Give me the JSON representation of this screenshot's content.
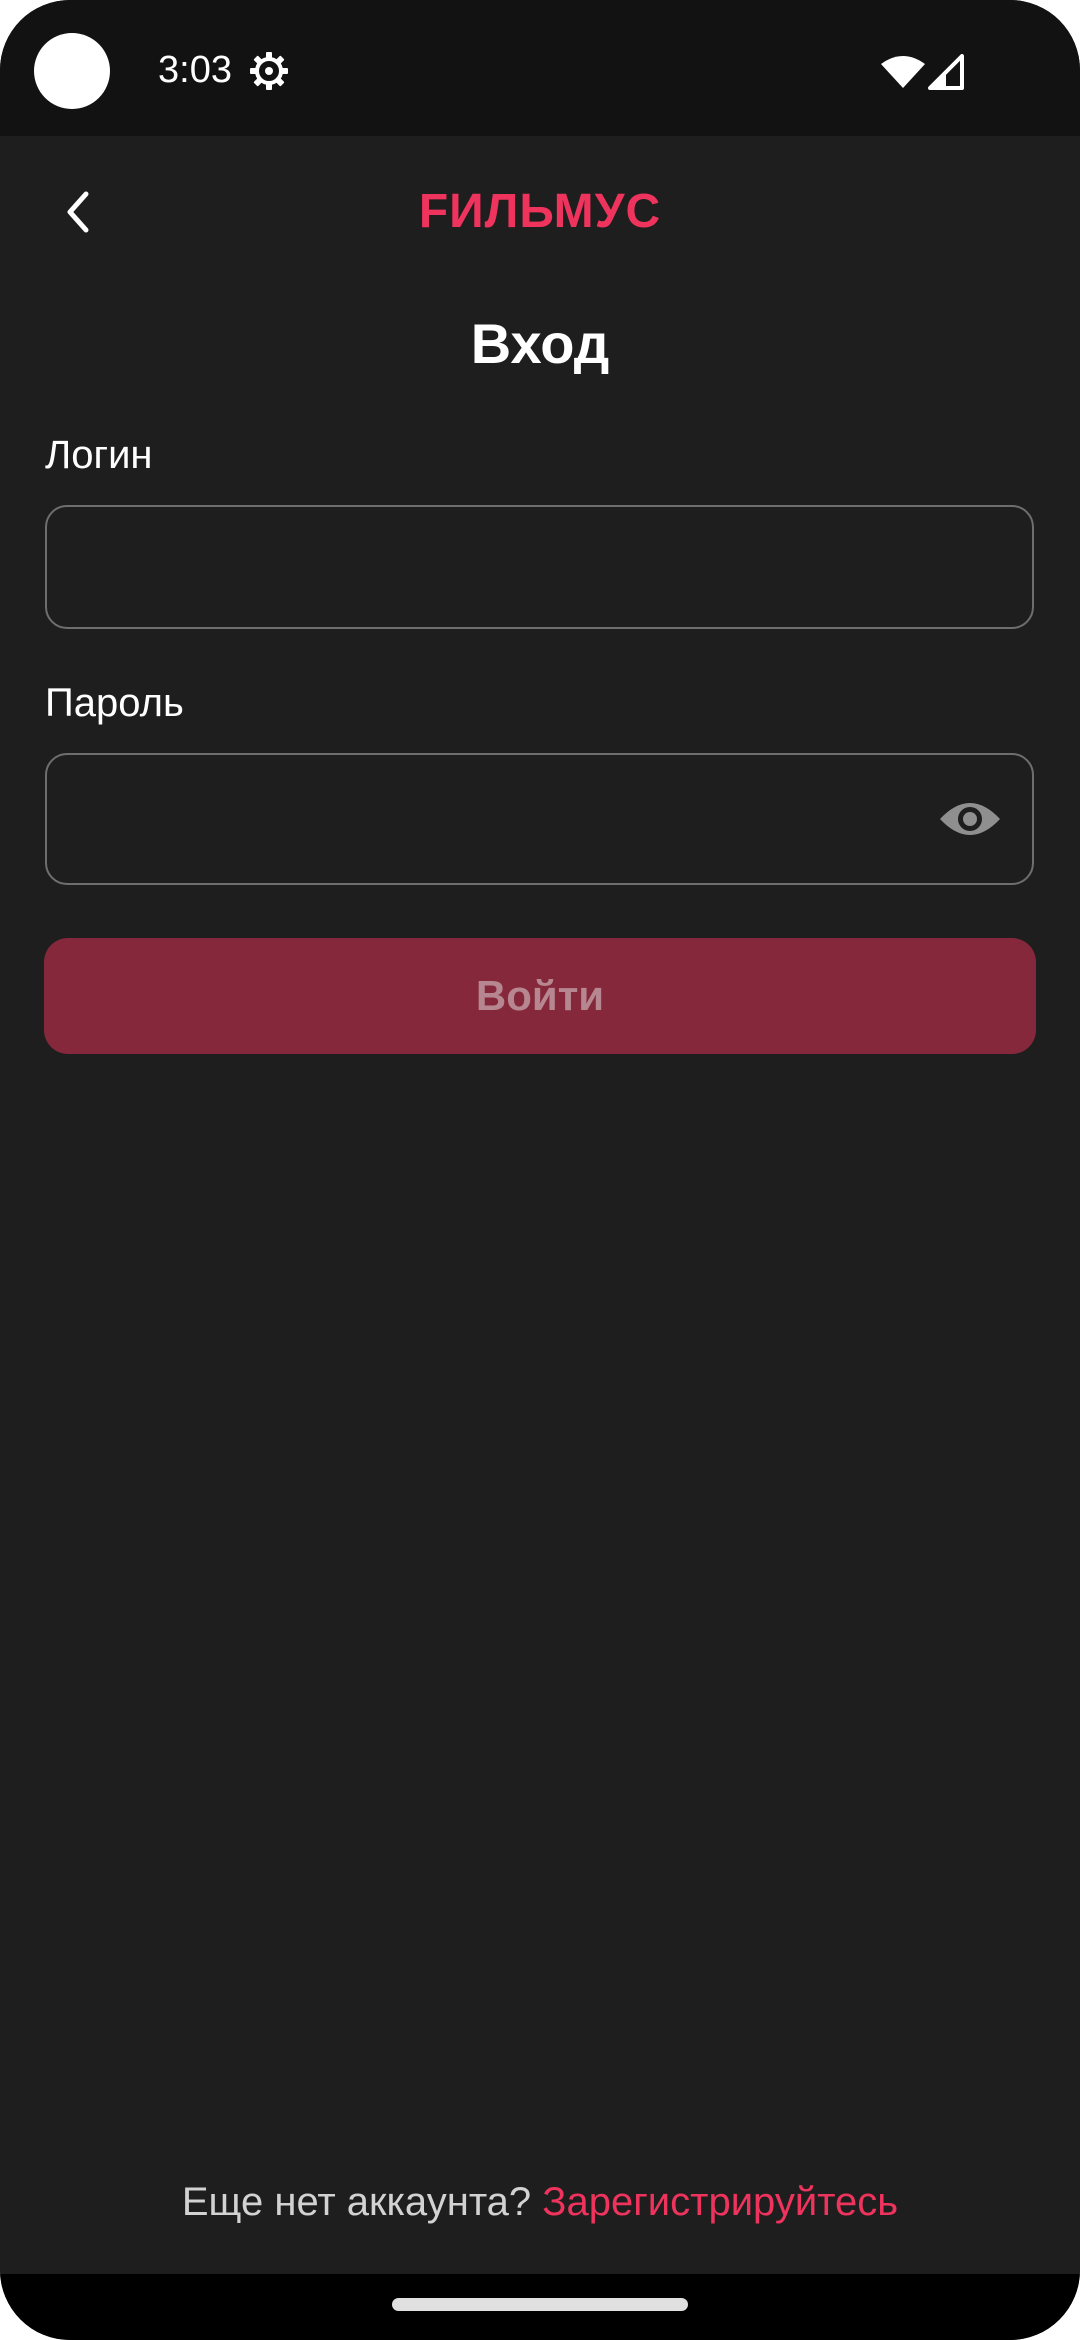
{
  "status_bar": {
    "time": "3:03",
    "icons": [
      "settings-icon",
      "wifi-icon",
      "signal-icon"
    ]
  },
  "header": {
    "back_icon": "chevron-left-icon",
    "logo_text": "FИЛЬМУС",
    "logo_color": "#ee335d"
  },
  "page": {
    "title": "Вход"
  },
  "form": {
    "login": {
      "label": "Логин",
      "value": "",
      "placeholder": ""
    },
    "password": {
      "label": "Пароль",
      "value": "",
      "placeholder": "",
      "toggle_icon": "eye-icon"
    },
    "submit_label": "Войти"
  },
  "footer": {
    "question": "Еще нет аккаунта?",
    "register_link": "Зарегистрируйтесь"
  },
  "colors": {
    "background": "#1e1e1e",
    "accent": "#ee335d",
    "button_disabled_bg": "#85283b",
    "button_disabled_text": "#b78791",
    "field_border": "#6e6e6e"
  }
}
